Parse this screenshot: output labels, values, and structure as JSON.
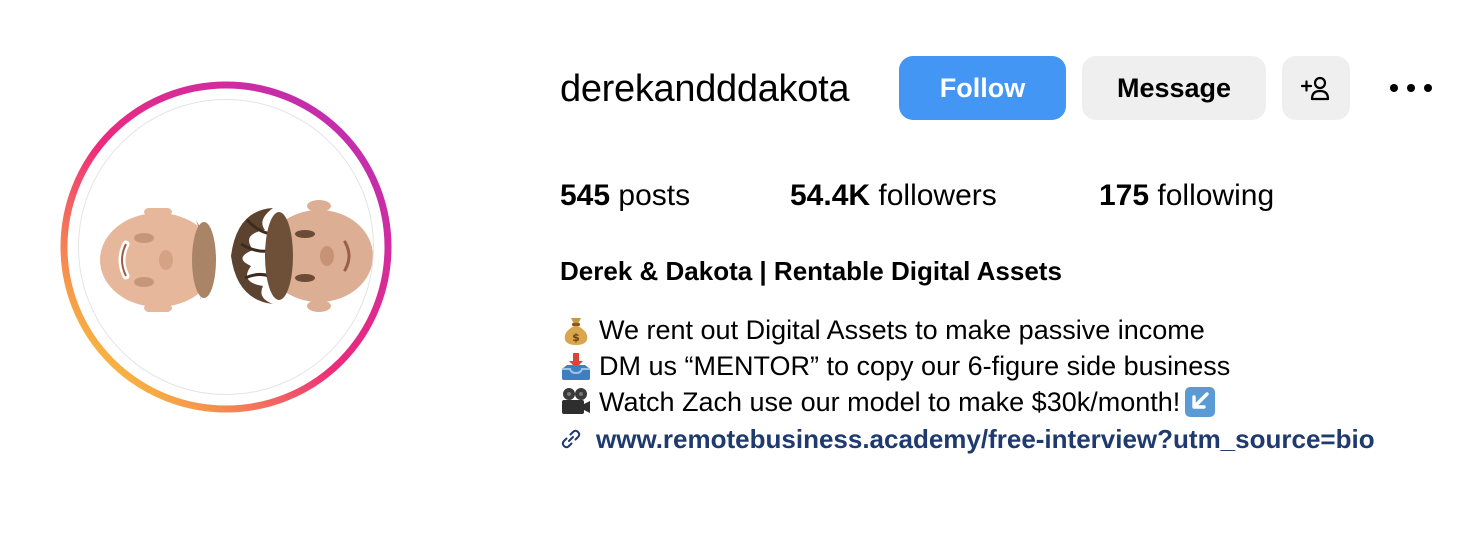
{
  "profile": {
    "username": "derekandddakota",
    "full_name": "Derek & Dakota | Rentable Digital Assets"
  },
  "actions": {
    "follow_label": "Follow",
    "message_label": "Message",
    "add_user_icon": "person-add-icon",
    "more_icon": "more-horizontal-icon"
  },
  "stats": {
    "posts_count": "545",
    "posts_label": " posts",
    "followers_count": "54.4K",
    "followers_label": " followers",
    "following_count": "175",
    "following_label": " following"
  },
  "bio": {
    "lines": [
      {
        "icon": "money-bag-emoji",
        "text": "We rent out Digital Assets to make passive income"
      },
      {
        "icon": "inbox-tray-emoji",
        "text": "DM us “MENTOR” to copy our 6-figure side business"
      },
      {
        "icon": "movie-camera-emoji",
        "text": "Watch Zach use our model to make $30k/month! ",
        "trailing_icon": "down-left-arrow-emoji"
      }
    ],
    "link_icon": "link-icon",
    "link_text": "www.remotebusiness.academy/free-interview?utm_source=bio"
  },
  "colors": {
    "follow_button": "#4496f5",
    "secondary_button": "#efefef",
    "link": "#1f3a6e",
    "story_ring": [
      "#f9ce34",
      "#ee2a7b",
      "#b92eb9"
    ]
  }
}
